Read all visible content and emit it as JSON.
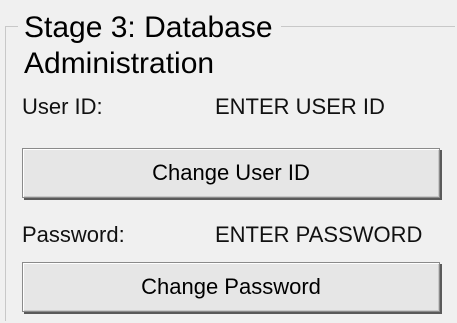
{
  "stage": {
    "title_line1": "Stage 3: Database",
    "title_line2": "Administration"
  },
  "user": {
    "label": "User ID:",
    "value": "ENTER USER ID",
    "button_label": "Change User ID"
  },
  "password": {
    "label": "Password:",
    "value": "ENTER PASSWORD",
    "button_label": "Change Password"
  }
}
